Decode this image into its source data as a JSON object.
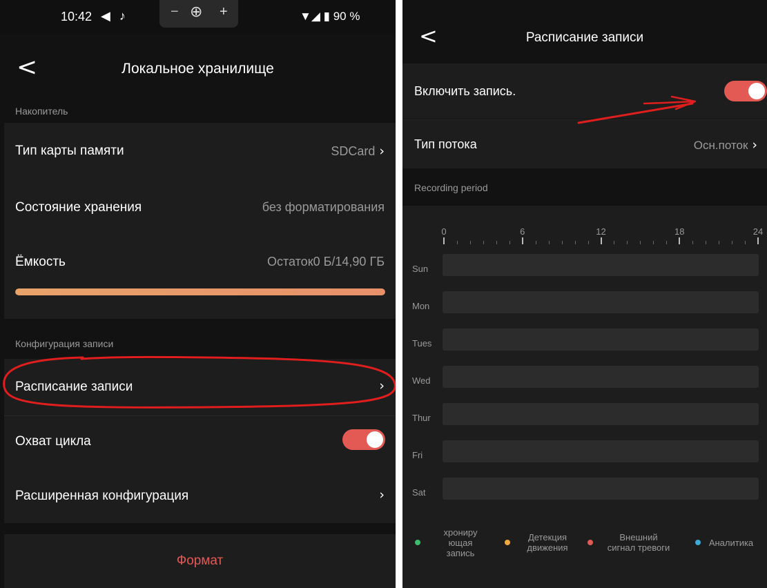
{
  "left": {
    "status_bar": {
      "time": "10:42",
      "left_icons": "◀ ♪",
      "zoom_minus": "−",
      "zoom_icon": "⊕",
      "zoom_plus": "+",
      "right_status": "▼◢ ▮ 90 %"
    },
    "back_glyph": "<",
    "title": "Локальное хранилище",
    "section_storage": "Накопитель",
    "memory_card_type": {
      "label": "Тип карты памяти",
      "value": "SDCard"
    },
    "storage_state": {
      "label": "Состояние хранения",
      "value": "без форматирования"
    },
    "capacity": {
      "label": "Ёмкость",
      "value": "Остаток0 Б/14,90 ГБ",
      "used_fraction": 1.0
    },
    "section_record_config": "Конфигурация записи",
    "record_schedule": {
      "label": "Расписание записи"
    },
    "loop_recording": {
      "label": "Охват цикла",
      "enabled": true
    },
    "advanced_config": {
      "label": "Расширенная конфигурация"
    },
    "format_button": "Формат",
    "chevron": "›"
  },
  "right": {
    "back_glyph": "<",
    "title": "Расписание записи",
    "enable_recording": {
      "label": "Включить запись.",
      "enabled": true
    },
    "stream_type": {
      "label": "Тип потока",
      "value": "Осн.поток"
    },
    "section_recording_period": "Recording period",
    "hour_ticks": [
      "0",
      "6",
      "12",
      "18",
      "24"
    ],
    "days": [
      "Sun",
      "Mon",
      "Tues",
      "Wed",
      "Thur",
      "Fri",
      "Sat"
    ],
    "legend": [
      {
        "label": "хрониру\nющая\nзапись",
        "color": "#3dbd6a"
      },
      {
        "label": "Детекция\nдвижения",
        "color": "#f0a93a"
      },
      {
        "label": "Внешний\nсигнал тревоги",
        "color": "#e35a54"
      },
      {
        "label": "Аналитика",
        "color": "#3fa9d8"
      }
    ],
    "chevron": "›"
  },
  "colors": {
    "accent": "#e35a54",
    "annotation": "#e01e1e"
  }
}
